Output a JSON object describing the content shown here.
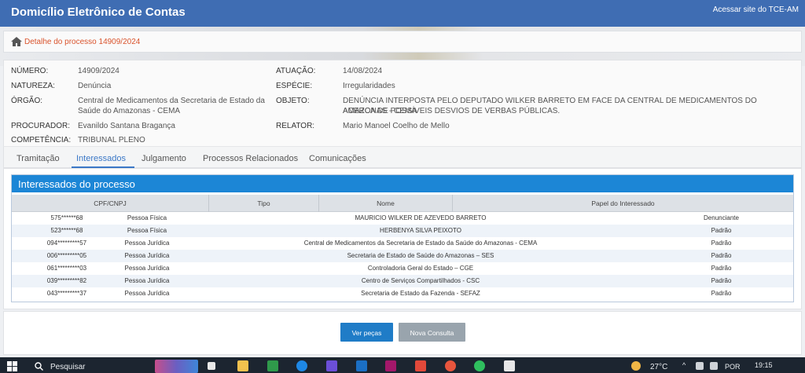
{
  "app": {
    "title": "Domicílio Eletrônico de Contas",
    "tce_link": "Acessar site do TCE-AM"
  },
  "breadcrumb": {
    "text": "Detalhe do processo 14909/2024"
  },
  "details": {
    "numero": {
      "label": "NÚMERO:",
      "value": "14909/2024"
    },
    "natureza": {
      "label": "NATUREZA:",
      "value": "Denúncia"
    },
    "orgao": {
      "label": "ÓRGÃO:",
      "value_line1": "Central de Medicamentos da Secretaria de Estado da",
      "value_line2": "Saúde do Amazonas - CEMA"
    },
    "procurador": {
      "label": "PROCURADOR:",
      "value": "Evanildo Santana Bragança"
    },
    "competencia": {
      "label": "COMPETÊNCIA:",
      "value": "TRIBUNAL PLENO"
    },
    "atuacao": {
      "label": "ATUAÇÃO:",
      "value": "14/08/2024"
    },
    "especie": {
      "label": "ESPÉCIE:",
      "value": "Irregularidades"
    },
    "objeto": {
      "label": "OBJETO:",
      "value_line1": "DENÚNCIA INTERPOSTA PELO DEPUTADO WILKER BARRETO EM FACE DA CENTRAL DE MEDICAMENTOS DO AMAZONAS - CEMA",
      "value_line2": "ACERCA DE POSSÍVEIS DESVIOS DE VERBAS PÚBLICAS."
    },
    "relator": {
      "label": "RELATOR:",
      "value": "Mario Manoel Coelho de Mello"
    }
  },
  "tabs": [
    "Tramitação",
    "Interessados",
    "Julgamento",
    "Processos Relacionados",
    "Comunicações"
  ],
  "grid": {
    "title": "Interessados do processo",
    "columns": [
      "CPF/CNPJ",
      "Tipo",
      "Nome",
      "Papel do Interessado"
    ],
    "rows": [
      [
        "575******68",
        "Pessoa Física",
        "MAURICIO WILKER DE AZEVEDO BARRETO",
        "Denunciante"
      ],
      [
        "523******68",
        "Pessoa Física",
        "HERBENYA SILVA PEIXOTO",
        "Padrão"
      ],
      [
        "094*********57",
        "Pessoa Jurídica",
        "Central de Medicamentos da Secretaria de Estado da Saúde do Amazonas - CEMA",
        "Padrão"
      ],
      [
        "006*********05",
        "Pessoa Jurídica",
        "Secretaria de Estado de Saúde do Amazonas – SES",
        "Padrão"
      ],
      [
        "061*********03",
        "Pessoa Jurídica",
        "Controladoria Geral do Estado – CGE",
        "Padrão"
      ],
      [
        "039*********82",
        "Pessoa Jurídica",
        "Centro de Serviços Compartilhados - CSC",
        "Padrão"
      ],
      [
        "043*********37",
        "Pessoa Jurídica",
        "Secretaria de Estado da Fazenda - SEFAZ",
        "Padrão"
      ]
    ]
  },
  "buttons": {
    "ver_pecas": "Ver peças",
    "nova_consulta": "Nova Consulta"
  },
  "taskbar": {
    "search_placeholder": "Pesquisar",
    "weather": "27°C",
    "lang": "POR",
    "time": "19:15"
  }
}
